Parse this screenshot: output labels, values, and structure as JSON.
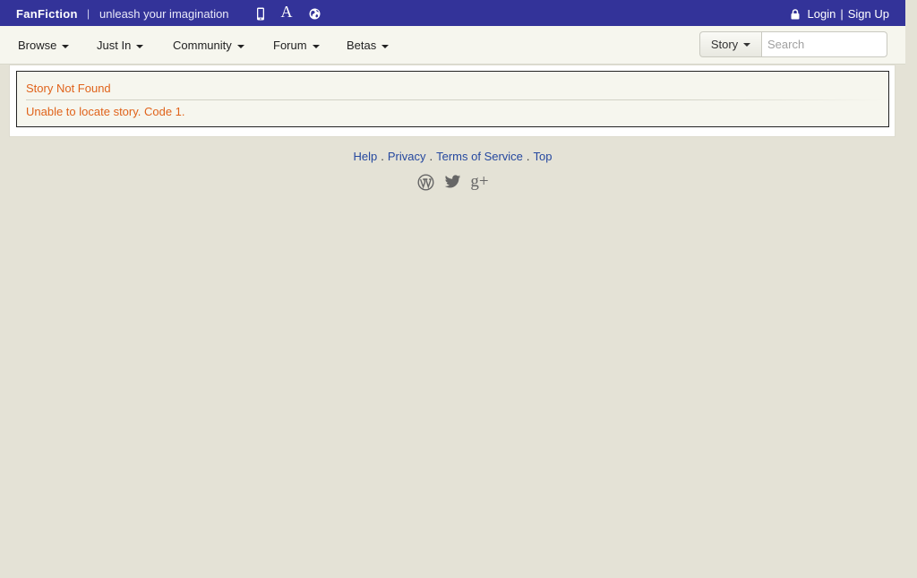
{
  "header": {
    "brand": "FanFiction",
    "separator": "|",
    "tagline": "unleash your imagination",
    "icons": [
      "phone-icon",
      "font-size-icon",
      "globe-icon"
    ],
    "login": "Login",
    "auth_separator": "|",
    "signup": "Sign Up",
    "color": "#333399"
  },
  "nav": {
    "items": [
      {
        "label": "Browse"
      },
      {
        "label": "Just In"
      },
      {
        "label": "Community"
      },
      {
        "label": "Forum"
      },
      {
        "label": "Betas"
      }
    ],
    "search_scope": "Story",
    "search_placeholder": "Search",
    "search_value": ""
  },
  "alert": {
    "title": "Story Not Found",
    "message": "Unable to locate story. Code 1.",
    "text_color": "#e0631b"
  },
  "footer": {
    "links": [
      "Help",
      "Privacy",
      "Terms of Service",
      "Top"
    ],
    "separator": ".",
    "social_icons": [
      "wordpress-icon",
      "twitter-icon",
      "google-plus-icon"
    ],
    "google_plus_glyph": "g+"
  }
}
